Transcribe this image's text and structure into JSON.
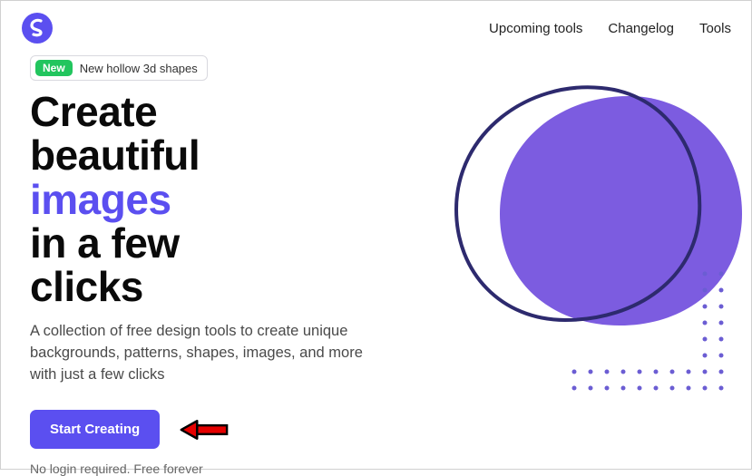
{
  "nav": {
    "upcoming": "Upcoming tools",
    "changelog": "Changelog",
    "tools": "Tools"
  },
  "badge": {
    "new": "New",
    "text": "New hollow 3d shapes"
  },
  "hero": {
    "line1": "Create",
    "line2": "beautiful",
    "accent": "images",
    "line3": "in a few",
    "line4": "clicks"
  },
  "subtitle": "A collection of free design tools to create unique backgrounds, patterns, shapes, images, and more with just a few clicks",
  "cta": "Start Creating",
  "footnote": "No login required. Free forever",
  "colors": {
    "accent": "#5b4ff0",
    "blob": "#7c5ce0",
    "blobOutline": "#2d2a6e",
    "green": "#22c55e"
  }
}
